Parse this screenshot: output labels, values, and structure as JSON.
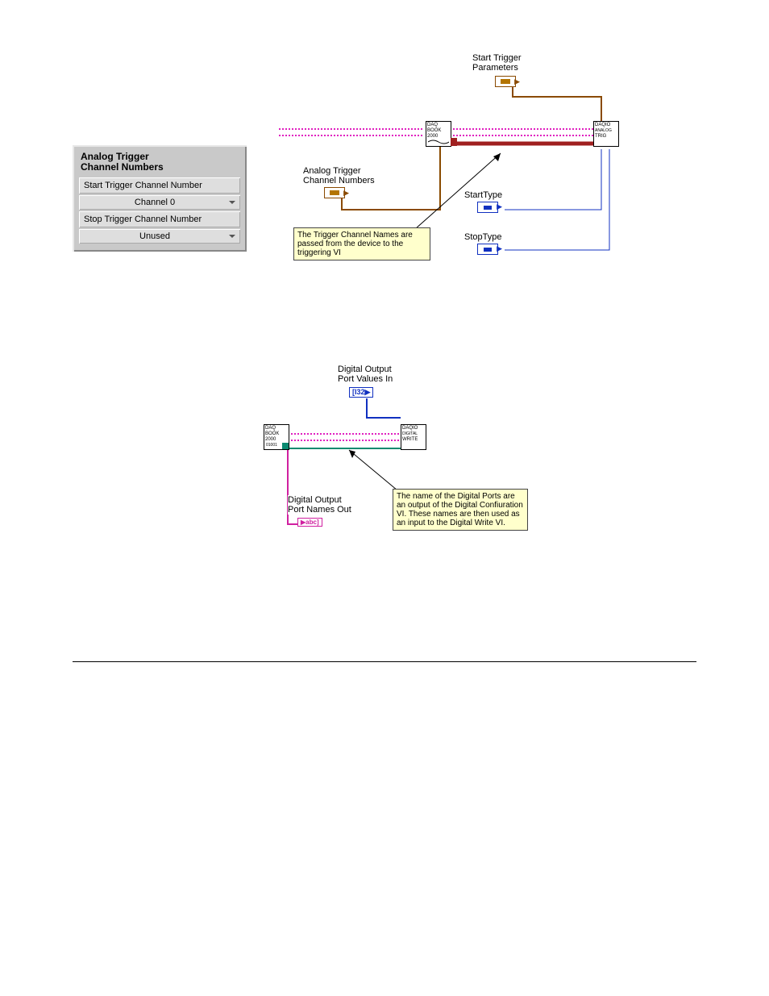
{
  "panel": {
    "title_line1": "Analog Trigger",
    "title_line2": "Channel Numbers",
    "start_label": "Start Trigger Channel Number",
    "start_value": "Channel 0",
    "stop_label": "Stop Trigger Channel Number",
    "stop_value": "Unused"
  },
  "diagram1": {
    "start_trig_label_l1": "Start Trigger",
    "start_trig_label_l2": "Parameters",
    "analog_trig_label_l1": "Analog Trigger",
    "analog_trig_label_l2": "Channel Numbers",
    "starttype_label": "StartType",
    "stoptype_label": "StopType",
    "vi_left_l1": "DAQ",
    "vi_left_l2": "BOOK",
    "vi_left_l3": "2000",
    "vi_right_l1": "DAQIO",
    "vi_right_l2": "ANALOG",
    "vi_right_l3": "TRIG",
    "comment": "The Trigger Channel Names are passed from the device to the triggering VI"
  },
  "diagram2": {
    "top_label_l1": "Digital Output",
    "top_label_l2": "Port Values In",
    "i32_label": "I32",
    "vi_left_l1": "DAQ",
    "vi_left_l2": "BOOK",
    "vi_left_l3": "2000",
    "vi_left_sub": "01001",
    "vi_right_l1": "DAQIO",
    "vi_right_l2": "DIGITAL",
    "vi_right_l3": "WRITE",
    "port_names_l1": "Digital Output",
    "port_names_l2": "Port Names Out",
    "abc_label": "abc",
    "comment": "The name of the Digital Ports are an output of the Digital Confiuration VI. These names are then used as an input to the Digital Write VI."
  }
}
